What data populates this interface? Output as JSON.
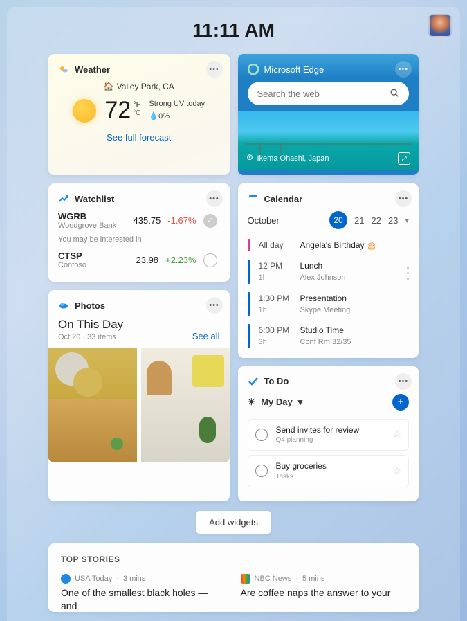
{
  "header": {
    "time": "11:11 AM"
  },
  "weather": {
    "title": "Weather",
    "location": "Valley Park, CA",
    "temp": "72",
    "unit_f": "°F",
    "unit_c": "°C",
    "condition": "Strong UV today",
    "precip": "0%",
    "link": "See full forecast"
  },
  "edge": {
    "title": "Microsoft Edge",
    "placeholder": "Search the web",
    "caption": "Ikema Ohashi, Japan"
  },
  "watchlist": {
    "title": "Watchlist",
    "rows": [
      {
        "symbol": "WGRB",
        "company": "Woodgrove Bank",
        "price": "435.75",
        "change": "-1.67%",
        "dir": "neg"
      }
    ],
    "hint": "You may be interested in",
    "suggest": [
      {
        "symbol": "CTSP",
        "company": "Contoso",
        "price": "23.98",
        "change": "+2.23%",
        "dir": "pos"
      }
    ]
  },
  "calendar": {
    "title": "Calendar",
    "month": "October",
    "dates": [
      "20",
      "21",
      "22",
      "23"
    ],
    "selected": "20",
    "events": [
      {
        "bar": "#d63c9c",
        "time": "All day",
        "dur": "",
        "title": "Angela's Birthday 🎂",
        "sub": ""
      },
      {
        "bar": "#0066cc",
        "time": "12 PM",
        "dur": "1h",
        "title": "Lunch",
        "sub": "Alex Johnson"
      },
      {
        "bar": "#0066cc",
        "time": "1:30 PM",
        "dur": "1h",
        "title": "Presentation",
        "sub": "Skype Meeting"
      },
      {
        "bar": "#0066cc",
        "time": "6:00 PM",
        "dur": "3h",
        "title": "Studio Time",
        "sub": "Conf Rm 32/35"
      }
    ]
  },
  "photos": {
    "title": "Photos",
    "heading": "On This Day",
    "sub": "Oct 20 · 33 items",
    "seeall": "See all"
  },
  "todo": {
    "title": "To Do",
    "myday": "My Day",
    "tasks": [
      {
        "title": "Send invites for review",
        "sub": "Q4 planning"
      },
      {
        "title": "Buy groceries",
        "sub": "Tasks"
      }
    ]
  },
  "addWidgets": "Add widgets",
  "stories": {
    "title": "TOP STORIES",
    "items": [
      {
        "source": "USA Today",
        "age": "3 mins",
        "headline": "One of the smallest black holes — and"
      },
      {
        "source": "NBC News",
        "age": "5 mins",
        "headline": "Are coffee naps the answer to your"
      }
    ]
  }
}
